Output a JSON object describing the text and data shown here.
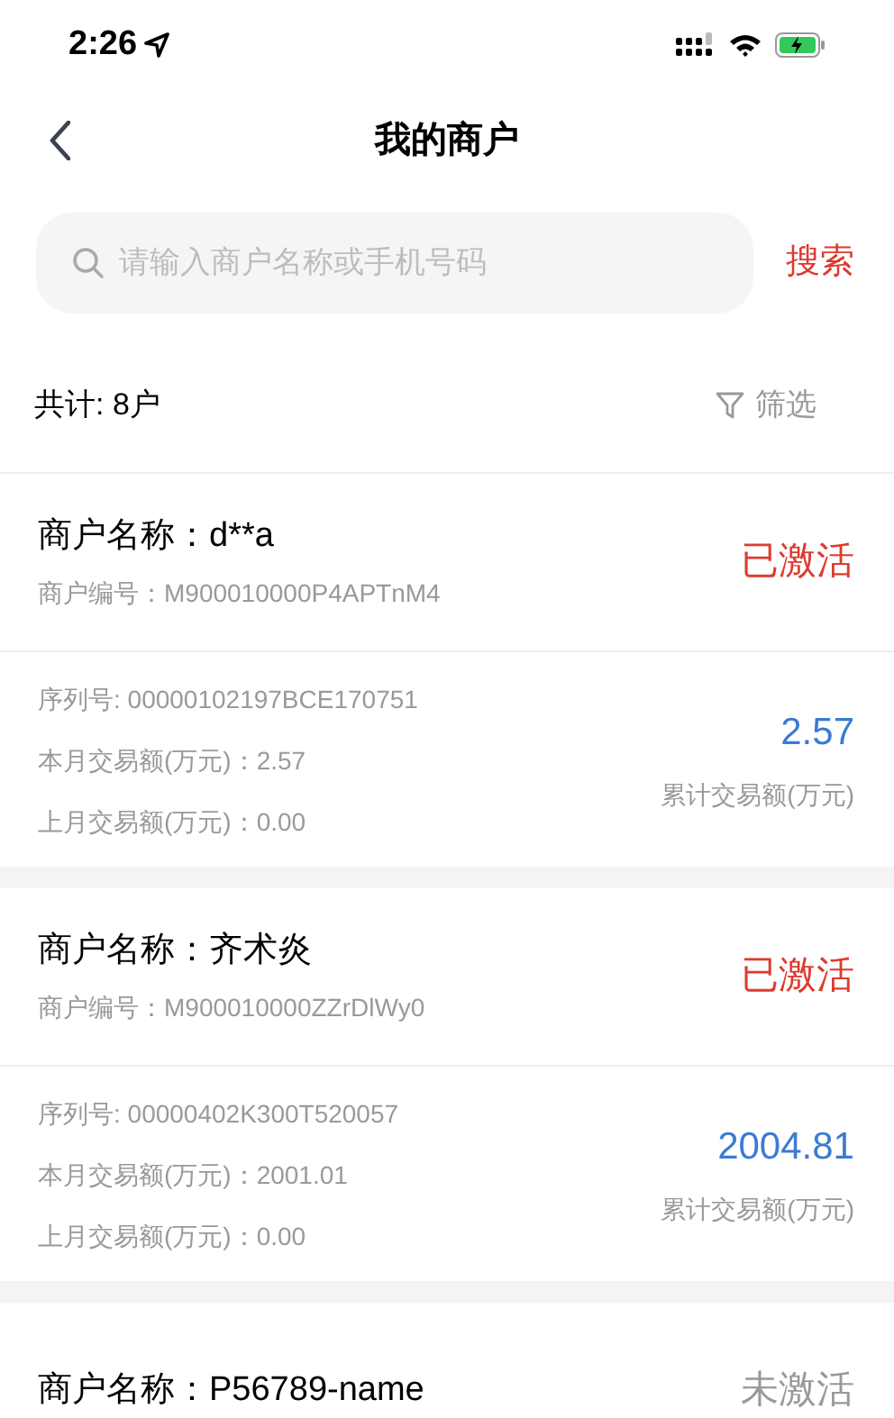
{
  "status_bar": {
    "time": "2:26"
  },
  "nav": {
    "title": "我的商户"
  },
  "search": {
    "placeholder": "请输入商户名称或手机号码",
    "button": "搜索"
  },
  "summary": {
    "total": "共计: 8户",
    "filter": "筛选"
  },
  "merchants": [
    {
      "name": "商户名称：d**a",
      "merchant_no": "商户编号：M900010000P4APTnM4",
      "status": "已激活",
      "activated": true,
      "serial": "序列号: 00000102197BCE170751",
      "this_month": "本月交易额(万元)：2.57",
      "last_month": "上月交易额(万元)：0.00",
      "total_amount": "2.57",
      "total_label": "累计交易额(万元)"
    },
    {
      "name": "商户名称：齐术炎",
      "merchant_no": "商户编号：M900010000ZZrDlWy0",
      "status": "已激活",
      "activated": true,
      "serial": "序列号: 00000402K300T520057",
      "this_month": "本月交易额(万元)：2001.01",
      "last_month": "上月交易额(万元)：0.00",
      "total_amount": "2004.81",
      "total_label": "累计交易额(万元)"
    },
    {
      "name": "商户名称：P56789-name",
      "status": "未激活",
      "activated": false
    }
  ]
}
